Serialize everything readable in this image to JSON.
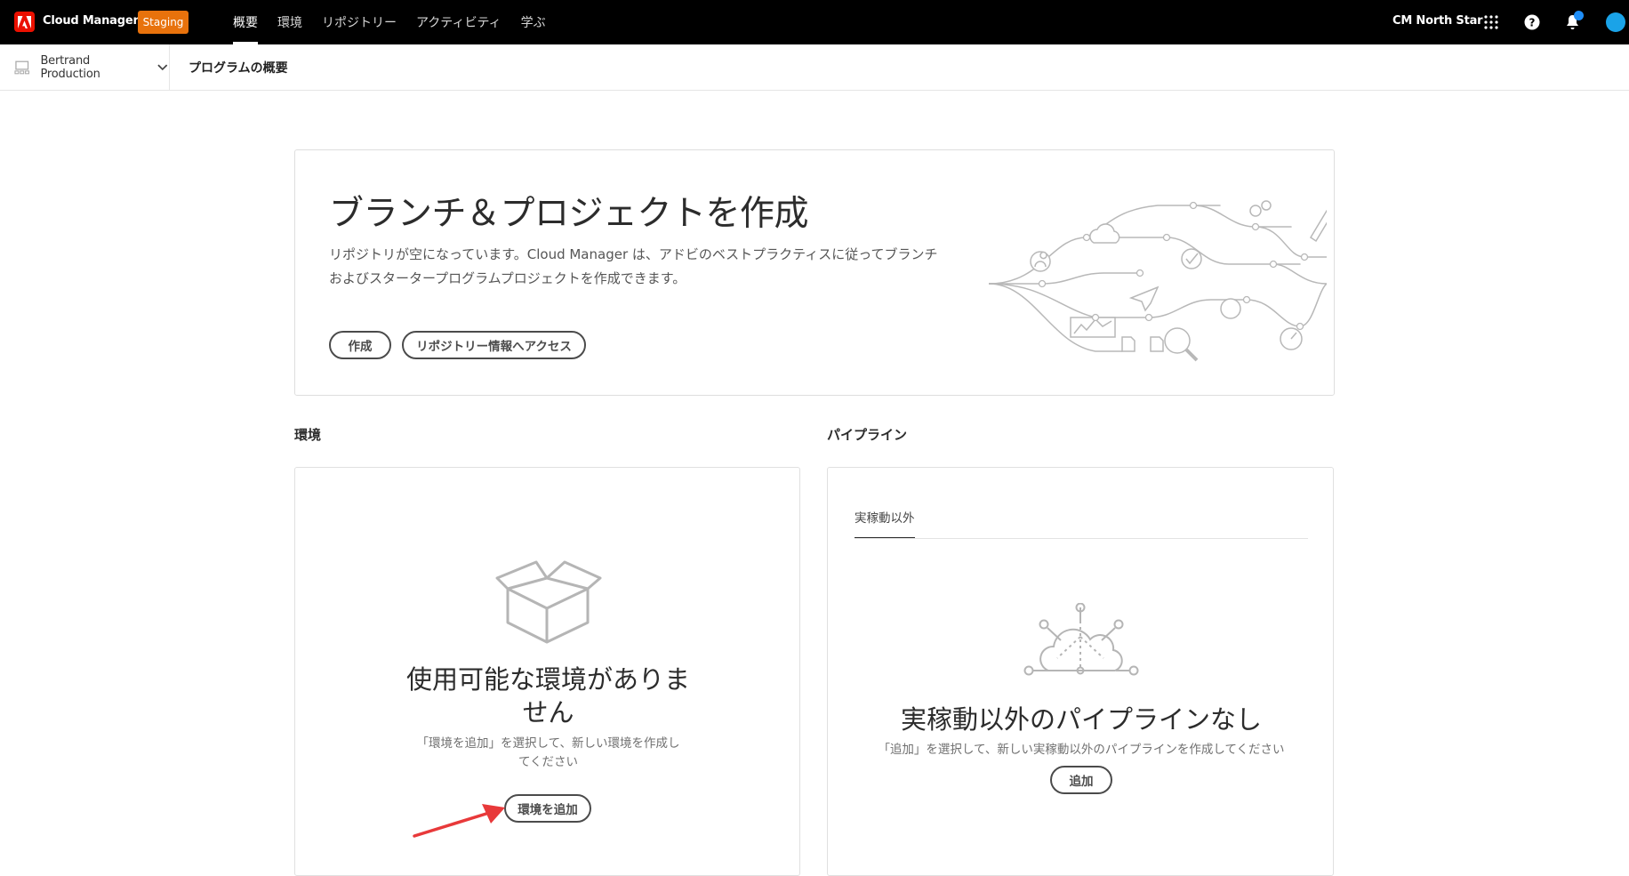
{
  "topbar": {
    "app_title": "Cloud Manager",
    "badge": "Staging",
    "nav": [
      {
        "label": "概要",
        "active": true
      },
      {
        "label": "環境",
        "active": false
      },
      {
        "label": "リポジトリー",
        "active": false
      },
      {
        "label": "アクティビティ",
        "active": false
      },
      {
        "label": "学ぶ",
        "active": false
      }
    ],
    "org_name": "CM North Star",
    "icons": [
      "app-switcher-icon",
      "help-icon",
      "bell-icon",
      "avatar"
    ]
  },
  "subbar": {
    "program_name": "Bertrand Production",
    "page_title": "プログラムの概要"
  },
  "hero": {
    "title": "ブランチ＆プロジェクトを作成",
    "description_line1": "リポジトリが空になっています。Cloud Manager は、アドビのベストプラクティスに従ってブランチ",
    "description_line2": "およびスタータープログラムプロジェクトを作成できます。",
    "create_button": "作成",
    "repo_info_button": "リポジトリー情報へアクセス"
  },
  "environments": {
    "section_label": "環境",
    "empty_title_line1": "使用可能な環境がありま",
    "empty_title_line2": "せん",
    "empty_desc_line1": "「環境を追加」を選択して、新しい環境を作成し",
    "empty_desc_line2": "てください",
    "add_button": "環境を追加"
  },
  "pipelines": {
    "section_label": "パイプライン",
    "tab_label": "実稼動以外",
    "empty_title": "実稼動以外のパイプラインなし",
    "empty_desc": "「追加」を選択して、新しい実稼動以外のパイプラインを作成してください",
    "add_button": "追加"
  },
  "colors": {
    "topbar_bg": "#000000",
    "badge_bg": "#e8720c",
    "logo_red": "#eb1000",
    "annotation_arrow": "#e8393a"
  }
}
